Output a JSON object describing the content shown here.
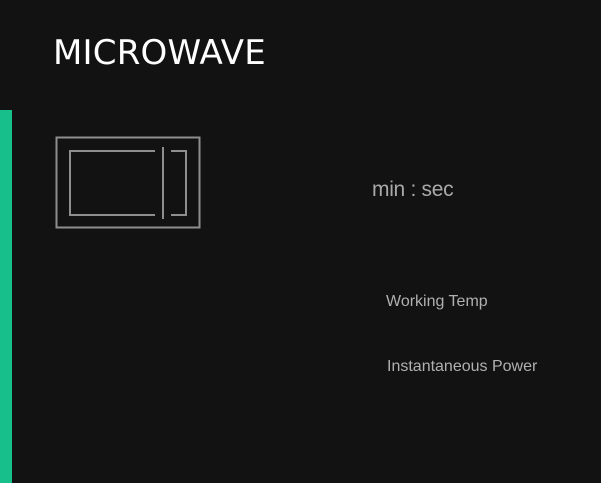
{
  "header": {
    "title": "MICROWAVE"
  },
  "device": {
    "icon": "microwave-icon",
    "accent_color": "#17c08b"
  },
  "timer": {
    "unit_label": "min : sec"
  },
  "metrics": {
    "working_temp_label": "Working Temp",
    "instantaneous_power_label": "Instantaneous Power"
  }
}
